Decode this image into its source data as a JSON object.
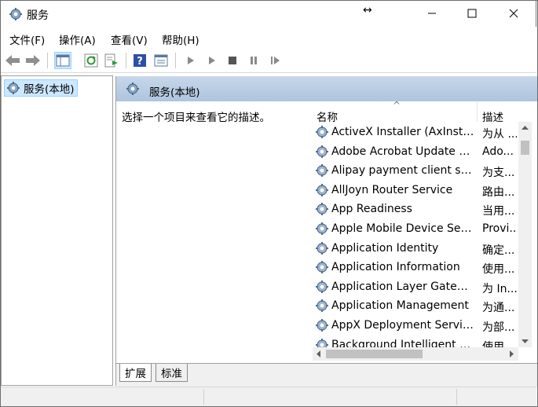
{
  "window": {
    "title": "服务",
    "resize_glyph": "↔"
  },
  "menu": {
    "items": [
      "文件(F)",
      "操作(A)",
      "查看(V)",
      "帮助(H)"
    ]
  },
  "toolbar": {
    "buttons": [
      "back-icon",
      "forward-icon",
      "show-hide-tree-icon",
      "refresh-icon",
      "export-list-icon",
      "help-icon",
      "properties-view-icon",
      "start-service-icon",
      "start-service-alt-icon",
      "stop-service-icon",
      "pause-service-icon",
      "resume-service-icon"
    ]
  },
  "tree": {
    "selected_label": "服务(本地)"
  },
  "main": {
    "header_title": "服务(本地)",
    "description_hint": "选择一个项目来查看它的描述。",
    "columns": {
      "name": "名称",
      "description": "描述"
    },
    "sort_glyph": "^",
    "rows": [
      {
        "name": "ActiveX Installer (AxInstSV)",
        "desc": "为从 ..."
      },
      {
        "name": "Adobe Acrobat Update Ser...",
        "desc": "Ado..."
      },
      {
        "name": "Alipay payment client secu...",
        "desc": "为支..."
      },
      {
        "name": "AllJoyn Router Service",
        "desc": "路由..."
      },
      {
        "name": "App Readiness",
        "desc": "当用..."
      },
      {
        "name": "Apple Mobile Device Servi...",
        "desc": "Provi..."
      },
      {
        "name": "Application Identity",
        "desc": "确定..."
      },
      {
        "name": "Application Information",
        "desc": "使用..."
      },
      {
        "name": "Application Layer Gateway ...",
        "desc": "为 In..."
      },
      {
        "name": "Application Management",
        "desc": "为通..."
      },
      {
        "name": "AppX Deployment Service ...",
        "desc": "为部..."
      },
      {
        "name": "Background Intelligent Tra...",
        "desc": "使用..."
      }
    ]
  },
  "tabs": {
    "extended": "扩展",
    "standard": "标准"
  },
  "colors": {
    "header_bg": "#aec4de",
    "selection_bg": "#cce8ff"
  }
}
